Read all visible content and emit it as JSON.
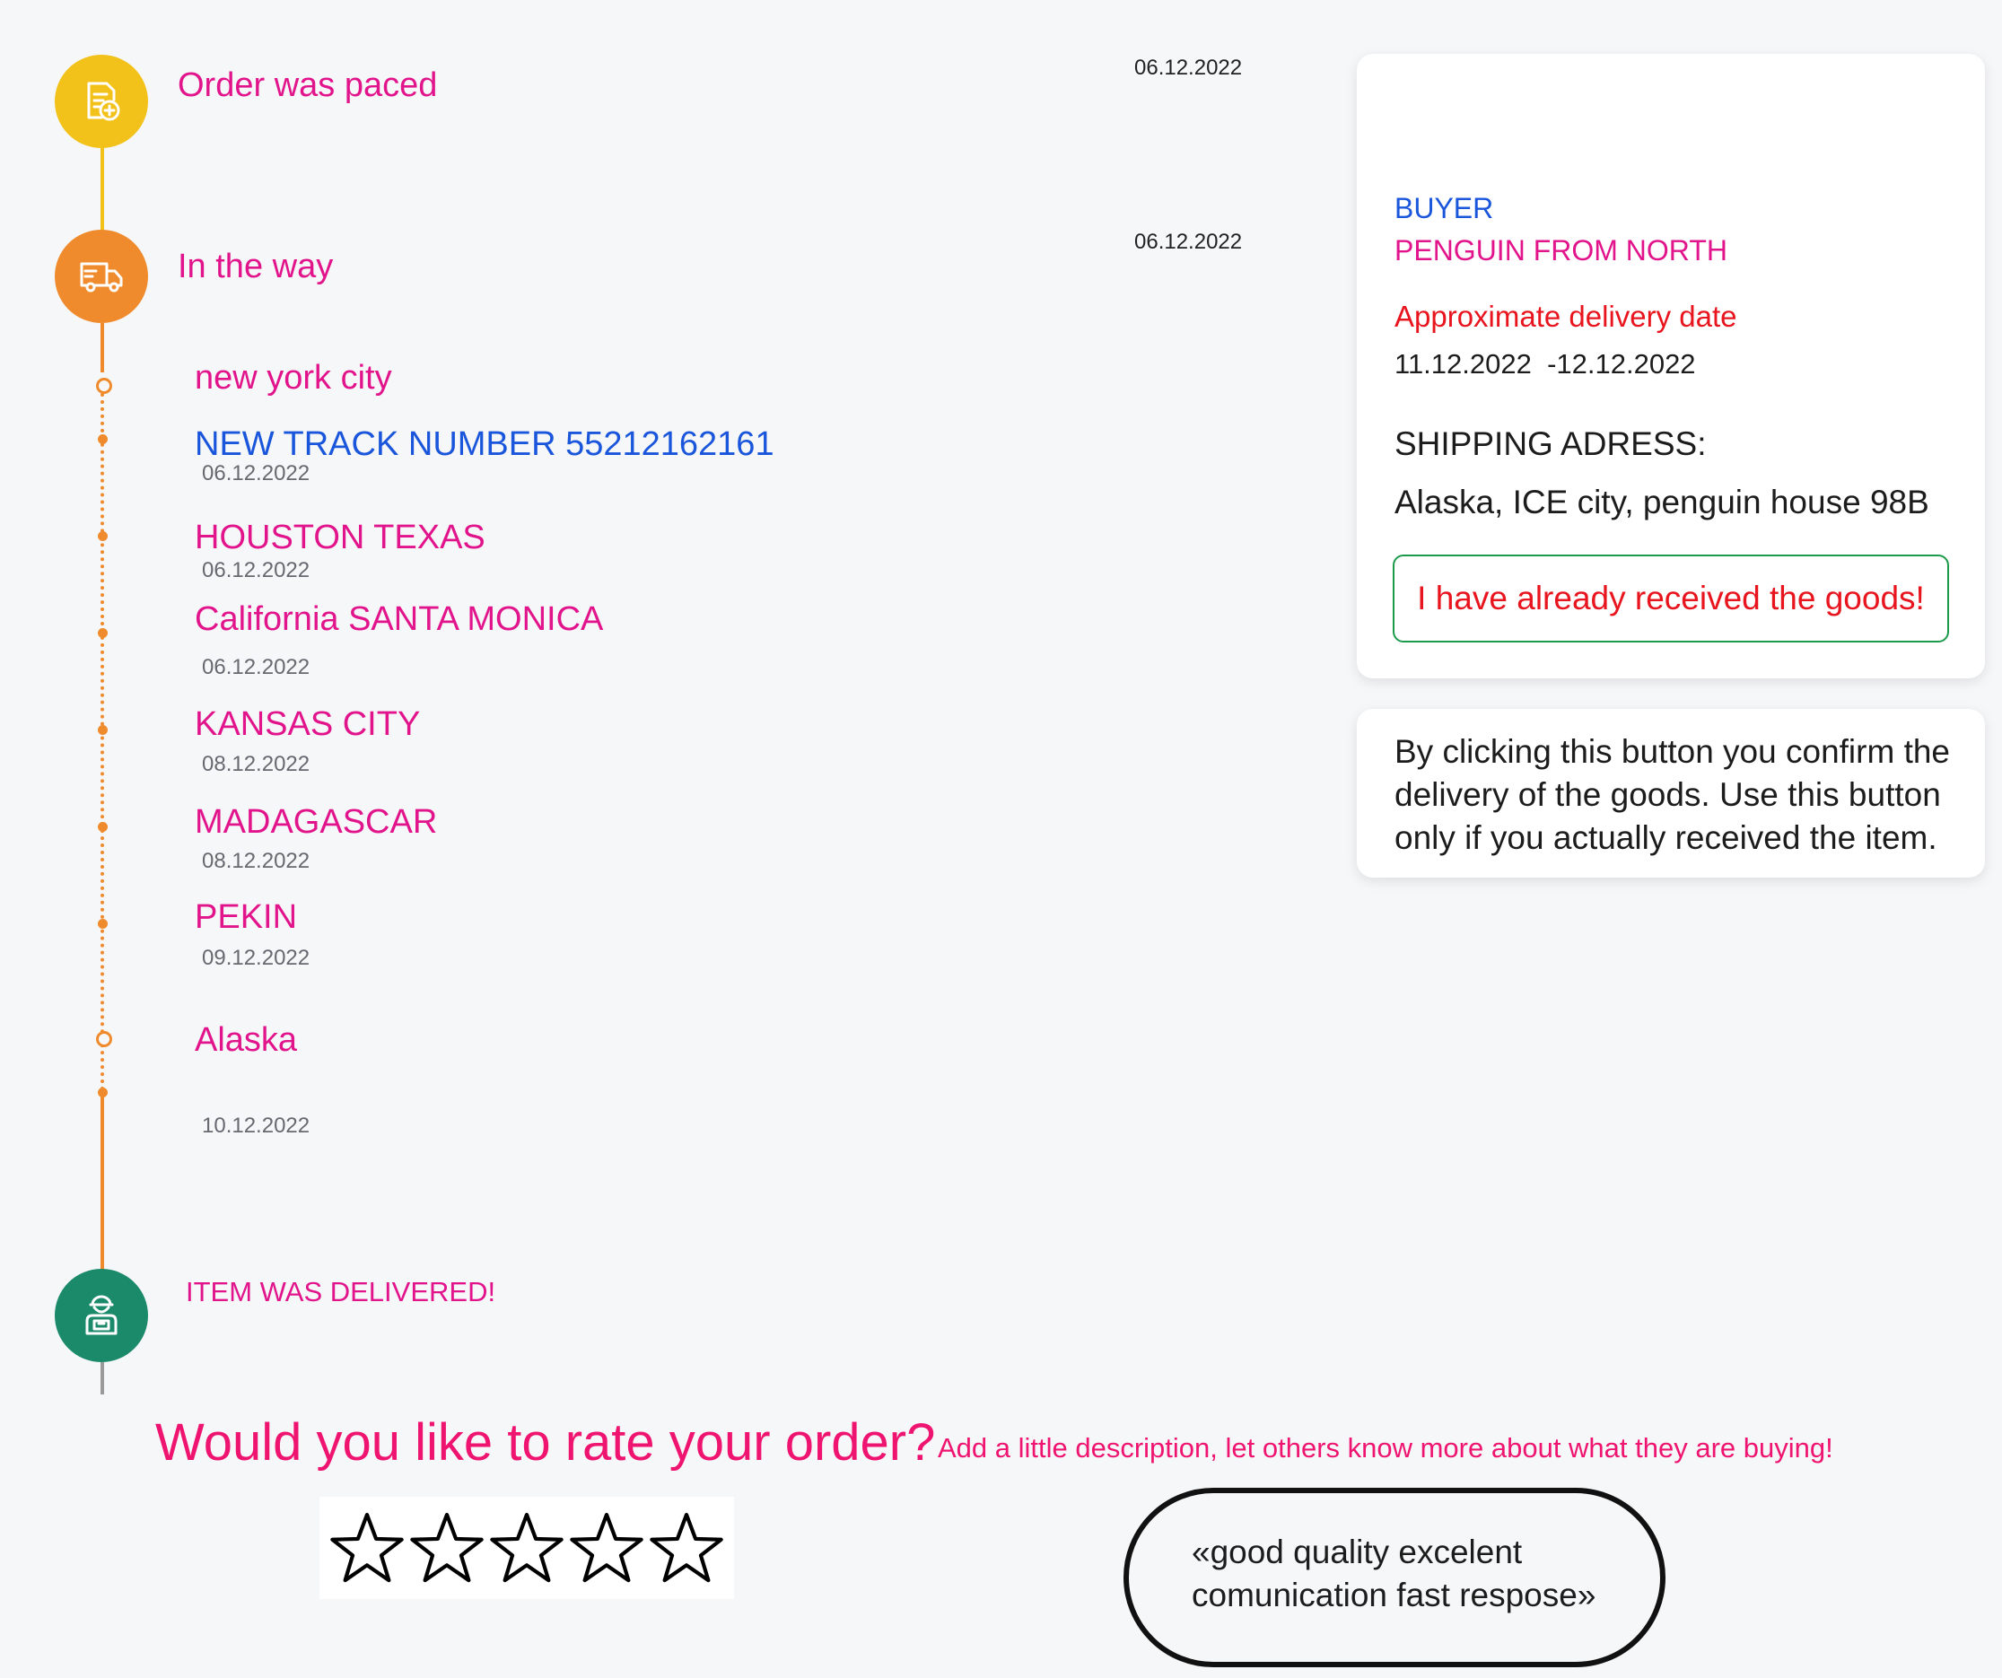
{
  "timeline": {
    "order_placed": {
      "title": "Order was paced",
      "date": "06.12.2022",
      "color": "#f2c21a",
      "icon": "order-document-add-icon"
    },
    "in_transit": {
      "title": "In the way",
      "date": "06.12.2022",
      "color": "#ef8b2c",
      "icon": "delivery-truck-icon"
    },
    "stops": [
      {
        "name": "new york city",
        "date": "",
        "color": "#e2148c"
      },
      {
        "name": "NEW TRACK NUMBER 55212162161",
        "date": "06.12.2022",
        "color": "#1a56db"
      },
      {
        "name": "HOUSTON TEXAS",
        "date": "06.12.2022",
        "color": "#e2148c"
      },
      {
        "name": "California SANTA MONICA",
        "date": "06.12.2022",
        "color": "#e2148c"
      },
      {
        "name": "KANSAS CITY",
        "date": "08.12.2022",
        "color": "#e2148c"
      },
      {
        "name": "MADAGASCAR",
        "date": "08.12.2022",
        "color": "#e2148c"
      },
      {
        "name": "PEKIN",
        "date": "09.12.2022",
        "color": "#e2148c"
      },
      {
        "name": "Alaska",
        "date": "10.12.2022",
        "color": "#e2148c"
      }
    ],
    "delivered": {
      "title": "ITEM WAS DELIVERED!",
      "color": "#1b8a6b",
      "icon": "courier-package-icon"
    }
  },
  "order_card": {
    "buyer_label": "BUYER",
    "buyer_name": "PENGUIN FROM NORTH",
    "delivery_label": "Approximate delivery date",
    "delivery_range": "11.12.2022  -12.12.2022",
    "shipping_label": "SHIPPING ADRESS:",
    "shipping_address": "Alaska, ICE city, penguin house 98B",
    "confirm_button": "I have already received the goods!"
  },
  "info_card": {
    "text": "By clicking this button you confirm the delivery of the goods. Use this button only if you actually received the item."
  },
  "rating": {
    "question": "Would you like to rate your order?",
    "hint": "Add a little description, let others know more about what they are buying!",
    "stars_total": 5,
    "stars_filled": 0,
    "review_text": "«good quality excelent comunication fast respose»"
  }
}
